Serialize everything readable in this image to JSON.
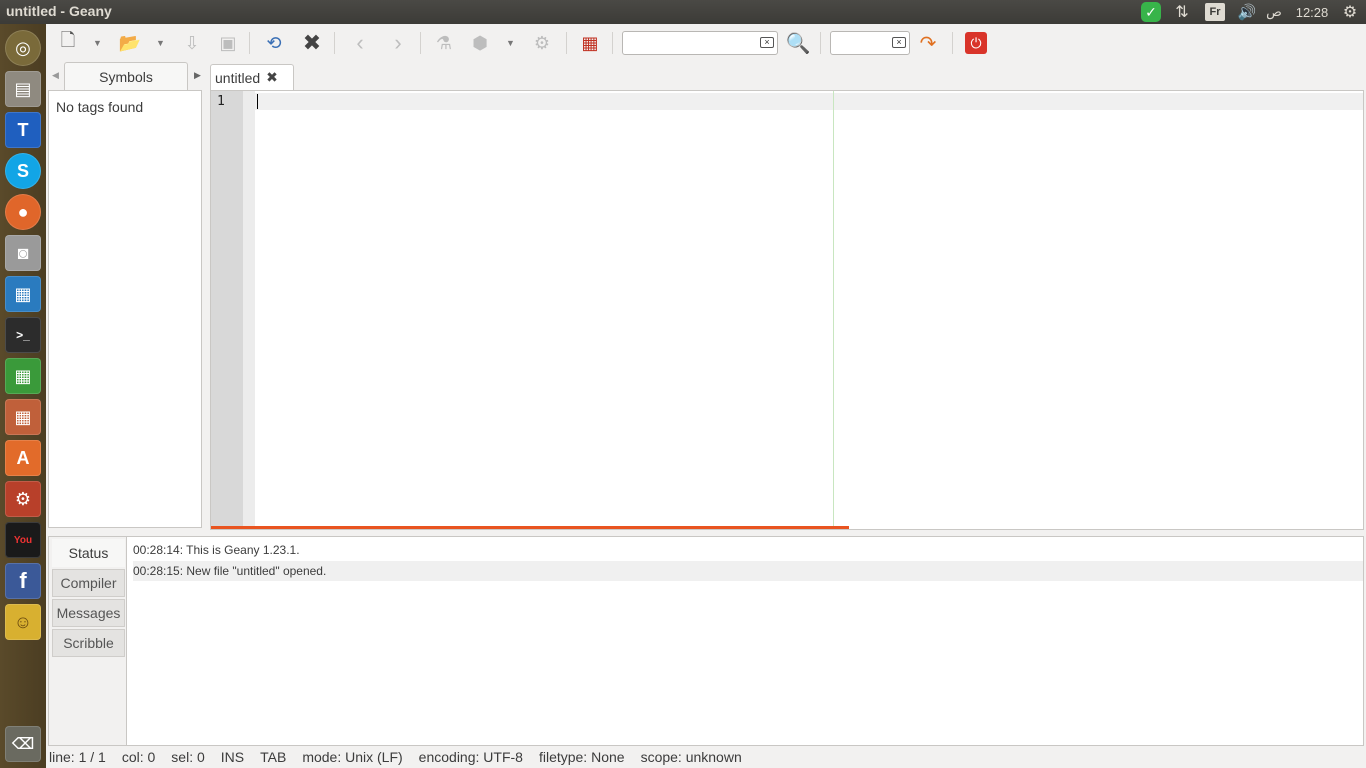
{
  "window": {
    "title": "untitled - Geany"
  },
  "system_tray": {
    "keyboard_layout": "Fr",
    "time": "12:28",
    "ampm": "ص"
  },
  "launcher": {
    "items": [
      {
        "name": "dash",
        "glyph": "◎"
      },
      {
        "name": "files",
        "glyph": "▤"
      },
      {
        "name": "text-editor",
        "glyph": "Ⓣ"
      },
      {
        "name": "skype",
        "glyph": "S"
      },
      {
        "name": "firefox",
        "glyph": "●"
      },
      {
        "name": "screenshot",
        "glyph": "◙"
      },
      {
        "name": "writer",
        "glyph": "▦"
      },
      {
        "name": "terminal",
        "glyph": ">_"
      },
      {
        "name": "calc",
        "glyph": "▦"
      },
      {
        "name": "impress",
        "glyph": "▦"
      },
      {
        "name": "software-center",
        "glyph": "A"
      },
      {
        "name": "system-settings",
        "glyph": "⚙"
      },
      {
        "name": "youtube",
        "glyph": "You"
      },
      {
        "name": "facebook",
        "glyph": "f"
      },
      {
        "name": "geany",
        "glyph": "☺"
      },
      {
        "name": "trash",
        "glyph": "🗑"
      }
    ]
  },
  "sidebar": {
    "tab_label": "Symbols",
    "empty_message": "No tags found"
  },
  "editor": {
    "tab_label": "untitled",
    "line_number": "1"
  },
  "messages": {
    "tabs": [
      "Status",
      "Compiler",
      "Messages",
      "Scribble"
    ],
    "lines": [
      "00:28:14: This is Geany 1.23.1.",
      "00:28:15: New file \"untitled\" opened."
    ]
  },
  "status": {
    "line": "line: 1 / 1",
    "col": "col: 0",
    "sel": "sel: 0",
    "ins": "INS",
    "tab": "TAB",
    "mode": "mode: Unix (LF)",
    "encoding": "encoding: UTF-8",
    "filetype": "filetype: None",
    "scope": "scope: unknown"
  },
  "colors": {
    "accent": "#e95420",
    "launcher_bg": "#4b3d22",
    "panel_bg": "#3c3b37"
  }
}
